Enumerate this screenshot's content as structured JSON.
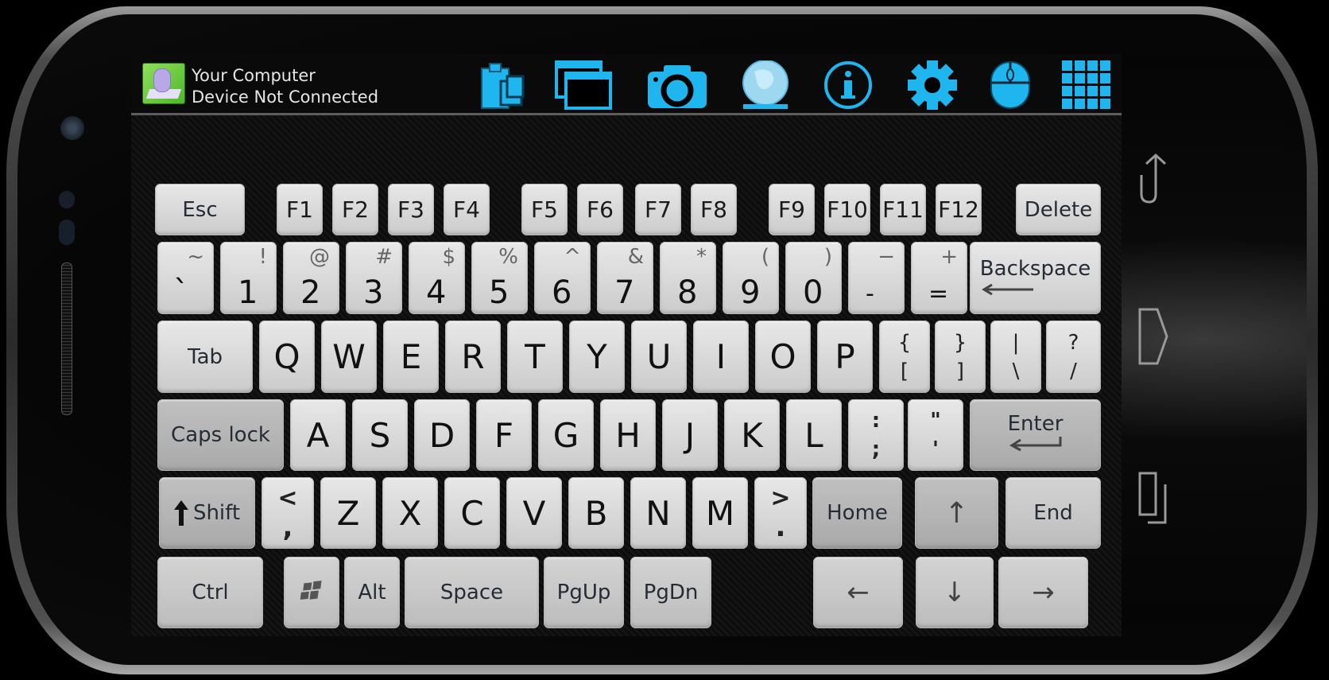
{
  "header": {
    "device_name": "Your Computer",
    "status": "Device Not Connected"
  },
  "toolbar": {
    "icons": [
      "clipboard-icon",
      "windows-icon",
      "camera-icon",
      "globe-icon",
      "info-icon",
      "settings-gear-icon",
      "mouse-icon",
      "grid-icon"
    ],
    "accent_color": "#1fb6f0"
  },
  "keyboard": {
    "function_row": {
      "esc": "Esc",
      "f": [
        "F1",
        "F2",
        "F3",
        "F4",
        "F5",
        "F6",
        "F7",
        "F8",
        "F9",
        "F10",
        "F11",
        "F12"
      ],
      "delete": "Delete"
    },
    "number_row": {
      "keys": [
        {
          "main": "`",
          "shift": "~"
        },
        {
          "main": "1",
          "shift": "!"
        },
        {
          "main": "2",
          "shift": "@"
        },
        {
          "main": "3",
          "shift": "#"
        },
        {
          "main": "4",
          "shift": "$"
        },
        {
          "main": "5",
          "shift": "%"
        },
        {
          "main": "6",
          "shift": "^"
        },
        {
          "main": "7",
          "shift": "&"
        },
        {
          "main": "8",
          "shift": "*"
        },
        {
          "main": "9",
          "shift": "("
        },
        {
          "main": "0",
          "shift": ")"
        },
        {
          "main": "-",
          "shift": "−"
        },
        {
          "main": "=",
          "shift": "+"
        }
      ],
      "backspace": "Backspace"
    },
    "qwerty_row": {
      "tab": "Tab",
      "letters": [
        "Q",
        "W",
        "E",
        "R",
        "T",
        "Y",
        "U",
        "I",
        "O",
        "P"
      ],
      "symbols": [
        {
          "top": "{",
          "bottom": "["
        },
        {
          "top": "}",
          "bottom": "]"
        },
        {
          "top": "|",
          "bottom": "\\"
        },
        {
          "top": "?",
          "bottom": "/"
        }
      ]
    },
    "home_row": {
      "caps": "Caps lock",
      "letters": [
        "A",
        "S",
        "D",
        "F",
        "G",
        "H",
        "J",
        "K",
        "L"
      ],
      "symbols": [
        {
          "top": ":",
          "bottom": ";"
        },
        {
          "top": "\"",
          "bottom": "'"
        }
      ],
      "enter": "Enter"
    },
    "shift_row": {
      "shift": "Shift",
      "comma": {
        "top": "<",
        "bottom": ","
      },
      "letters": [
        "Z",
        "X",
        "C",
        "V",
        "B",
        "N",
        "M"
      ],
      "period": {
        "top": ">",
        "bottom": "."
      },
      "home": "Home",
      "up": "↑",
      "end": "End"
    },
    "bottom_row": {
      "ctrl": "Ctrl",
      "alt": "Alt",
      "space": "Space",
      "pgup": "PgUp",
      "pgdn": "PgDn",
      "left": "←",
      "down": "↓",
      "right": "→"
    }
  },
  "system_nav": {
    "buttons": [
      "back",
      "home",
      "recent-apps"
    ]
  }
}
